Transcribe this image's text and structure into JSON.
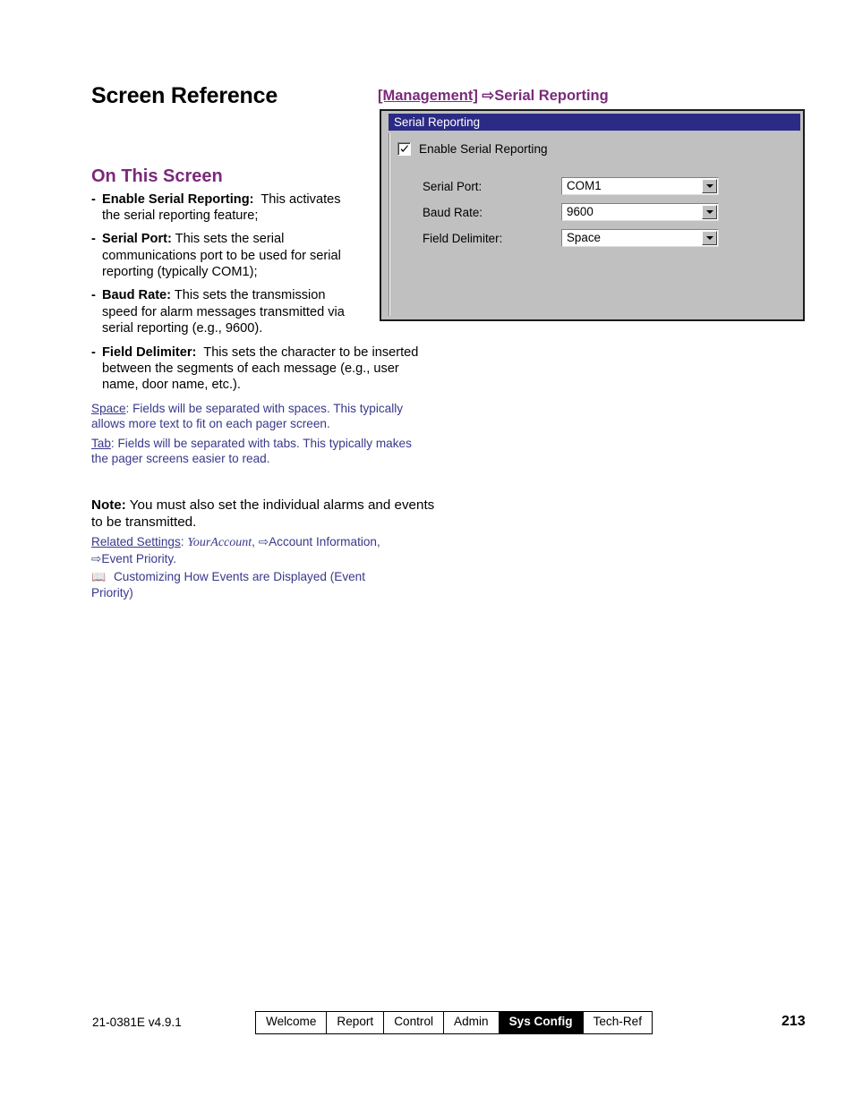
{
  "page": {
    "title": "Screen Reference",
    "section_heading": "On This Screen"
  },
  "bullets": [
    {
      "term": "Enable Serial Reporting:",
      "text": "This activates the serial reporting feature;"
    },
    {
      "term": "Serial Port:",
      "text": "This sets the serial communications port to be used for serial reporting (typically COM1);"
    },
    {
      "term": "Baud Rate:",
      "text": "This sets the transmission speed for alarm messages transmitted via serial reporting (e.g., 9600)."
    },
    {
      "term": "Field Delimiter:",
      "text": "This sets the character to be inserted between the segments of each message (e.g., user name, door name, etc.)."
    }
  ],
  "delimiter_notes": [
    {
      "lead": "Space",
      "text": ":  Fields will be separated with spaces.  This typically allows more text to fit on each pager screen."
    },
    {
      "lead": "Tab",
      "text": ":  Fields will be separated with tabs.  This typically makes the pager screens easier to read."
    }
  ],
  "note": {
    "label": "Note:",
    "text": " You must also set the individual alarms and events to be transmitted."
  },
  "related_settings": {
    "label": "Related Settings",
    "separator": ":  ",
    "account": "YourAccount",
    "path1": ", ⇨Account Information,",
    "path2": "⇨Event Priority."
  },
  "reference": {
    "book_icon": "book-icon",
    "text": " Customizing How Events are Displayed (Event Priority)"
  },
  "dialog": {
    "breadcrumb_management": "[Management]",
    "breadcrumb_arrow_label": " ⇨",
    "breadcrumb_screen": "Serial Reporting",
    "titlebar": "Serial Reporting",
    "checkbox": {
      "label": "Enable Serial Reporting",
      "checked": true,
      "icon": "checkmark-icon"
    },
    "fields": [
      {
        "label": "Serial Port:",
        "value": "COM1",
        "icon": "chevron-down-icon"
      },
      {
        "label": "Baud Rate:",
        "value": "9600",
        "icon": "chevron-down-icon"
      },
      {
        "label": "Field Delimiter:",
        "value": "Space",
        "icon": "chevron-down-icon"
      }
    ],
    "colors": {
      "titlebar_bg": "#2B2B85",
      "dialog_bg": "#C0C0C0",
      "heading": "#7A2A7A"
    }
  },
  "footer": {
    "doc_code": "21-0381E v4.9.1",
    "tabs": [
      {
        "label": "Welcome",
        "active": false
      },
      {
        "label": "Report",
        "active": false
      },
      {
        "label": "Control",
        "active": false
      },
      {
        "label": "Admin",
        "active": false
      },
      {
        "label": "Sys Config",
        "active": true
      },
      {
        "label": "Tech-Ref",
        "active": false
      }
    ],
    "page_number": "213"
  }
}
